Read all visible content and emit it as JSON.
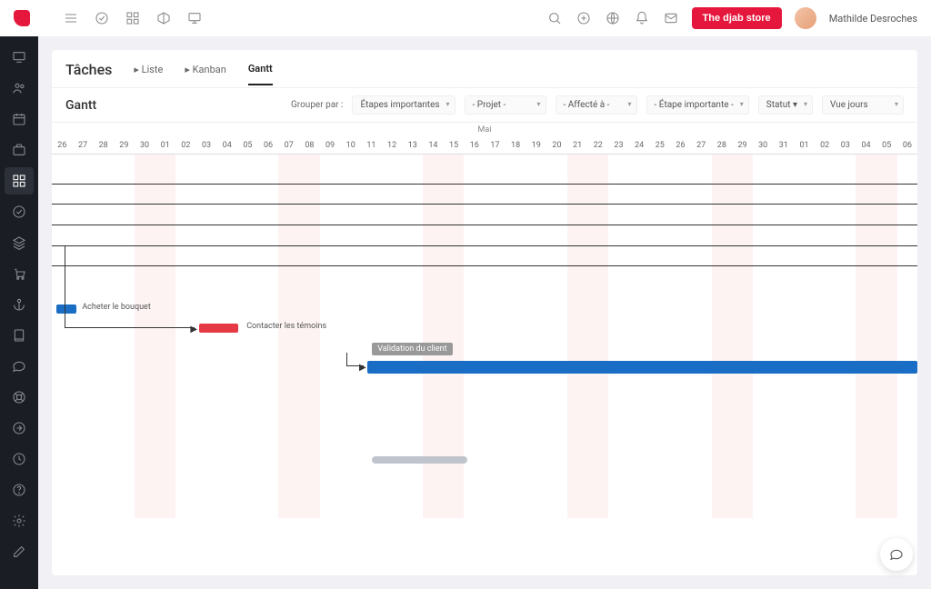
{
  "topbar": {
    "store_button": "The djab store",
    "username": "Mathilde Desroches"
  },
  "page": {
    "title": "Tâches",
    "tabs": [
      {
        "label": "▸ Liste"
      },
      {
        "label": "▸ Kanban"
      },
      {
        "label": "Gantt",
        "active": true
      }
    ],
    "gantt_label": "Gantt"
  },
  "filters": {
    "group_by_label": "Grouper par :",
    "dropdowns": [
      "Étapes importantes",
      "- Projet -",
      "- Affecté à -",
      "- Étape importante -",
      "Statut ▾",
      "Vue jours"
    ]
  },
  "timeline": {
    "month": "Mai",
    "days": [
      "26",
      "27",
      "28",
      "29",
      "30",
      "01",
      "02",
      "03",
      "04",
      "05",
      "06",
      "07",
      "08",
      "09",
      "10",
      "11",
      "12",
      "13",
      "14",
      "15",
      "16",
      "17",
      "18",
      "19",
      "20",
      "21",
      "22",
      "23",
      "24",
      "25",
      "26",
      "27",
      "28",
      "29",
      "30",
      "31",
      "01",
      "02",
      "03",
      "04",
      "05",
      "06"
    ],
    "weekend_cols": [
      4,
      5,
      11,
      12,
      18,
      19,
      25,
      26,
      32,
      33,
      39,
      40
    ]
  },
  "tasks": {
    "t1": {
      "label": "Acheter le bouquet",
      "color": "#1a6dc4"
    },
    "t2": {
      "label": "Contacter les témoins",
      "color": "#e63946"
    },
    "milestone": {
      "label": "Validation du client"
    },
    "t3": {
      "color": "#1a6dc4"
    }
  }
}
